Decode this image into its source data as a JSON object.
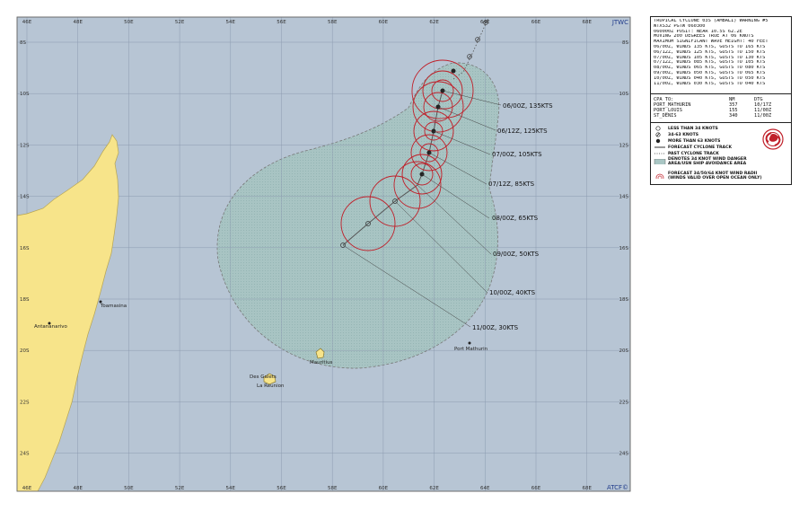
{
  "source_tag": "JTWC",
  "producer_tag": "ATCF©",
  "lon_labels": [
    "46E",
    "48E",
    "50E",
    "52E",
    "54E",
    "56E",
    "58E",
    "60E",
    "62E",
    "64E",
    "66E",
    "68E"
  ],
  "lat_labels": [
    "8S",
    "10S",
    "12S",
    "14S",
    "16S",
    "18S",
    "20S",
    "22S",
    "24S"
  ],
  "places": {
    "antananarivo": "Antananarivo",
    "toamasina": "Toamasina",
    "mauritius": "Mauritius",
    "des_galets": "Des Galets",
    "la_reunion": "La Reunion",
    "port_mathurin": "Port Mathurin"
  },
  "forecast_labels": [
    "06/00Z, 135KTS",
    "06/12Z, 125KTS",
    "07/00Z, 105KTS",
    "07/12Z, 85KTS",
    "08/00Z, 65KTS",
    "09/00Z, 50KTS",
    "10/00Z, 40KTS",
    "11/00Z, 30KTS"
  ],
  "warning_text": [
    "TROPICAL CYCLONE 03S (AMBALI) WARNING #5",
    "WTXS32 PGTW 060300",
    "060000Z POSIT: NEAR 10.5S 62.2E",
    "MOVING 200 DEGREES TRUE AT 06 KNOTS",
    "MAXIMUM SIGNIFICANT WAVE HEIGHT: 40 FEET",
    "06/00Z, WINDS 135 KTS, GUSTS TO 165 KTS",
    "06/12Z, WINDS 125 KTS, GUSTS TO 150 KTS",
    "07/00Z, WINDS 105 KTS, GUSTS TO 130 KTS",
    "07/12Z, WINDS 085 KTS, GUSTS TO 105 KTS",
    "08/00Z, WINDS 065 KTS, GUSTS TO 080 KTS",
    "09/00Z, WINDS 050 KTS, GUSTS TO 065 KTS",
    "10/00Z, WINDS 040 KTS, GUSTS TO 050 KTS",
    "11/00Z, WINDS 030 KTS, GUSTS TO 040 KTS"
  ],
  "cpa": {
    "header": [
      "CPA TO:",
      "NM",
      "DTG"
    ],
    "rows": [
      [
        "PORT_MATHURIN",
        "357",
        "10/17Z"
      ],
      [
        "PORT_LOUIS",
        "155",
        "11/00Z"
      ],
      [
        "ST_DENIS",
        "340",
        "11/00Z"
      ]
    ]
  },
  "legend": {
    "less34": "LESS THAN 34 KNOTS",
    "k34_63": "34-63 KNOTS",
    "more63": "MORE THAN 63 KNOTS",
    "forecast_track": "FORECAST CYCLONE TRACK",
    "past_track": "PAST CYCLONE TRACK",
    "danger_area": "DENOTES 34 KNOT WIND DANGER",
    "danger_area2": "AREA/USN SHIP AVOIDANCE AREA",
    "radii": "FORECAST 34/50/64 KNOT WIND RADII",
    "radii2": "(WINDS VALID OVER OPEN OCEAN ONLY)"
  },
  "colors": {
    "sea": "#b7c5d4",
    "land": "#f7e48a",
    "danger": "#a9c6c4",
    "radii": "#c0202a",
    "track": "#555555"
  }
}
